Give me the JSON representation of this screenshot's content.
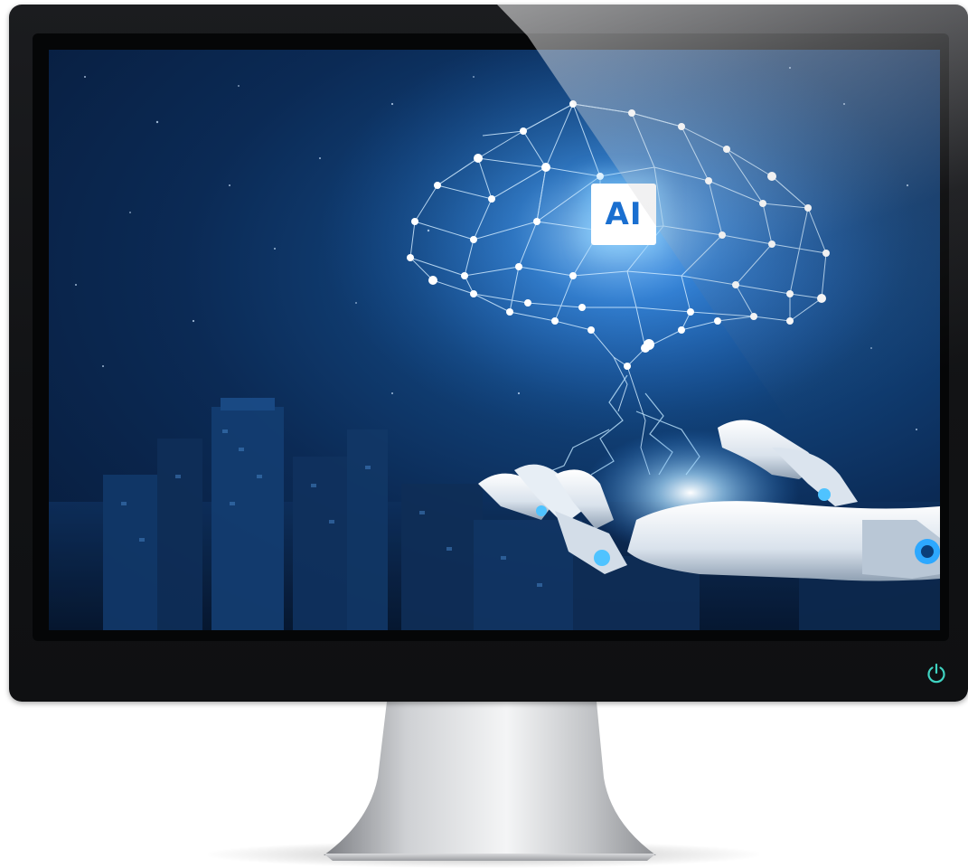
{
  "screen": {
    "chip_label": "AI"
  },
  "colors": {
    "bezel": "#121315",
    "screen_glow": "#1e64b8",
    "screen_dark": "#071a38",
    "power_led": "#3fd4c2",
    "chip_text": "#1a6fd0"
  },
  "icons": {
    "power": "power-icon"
  }
}
